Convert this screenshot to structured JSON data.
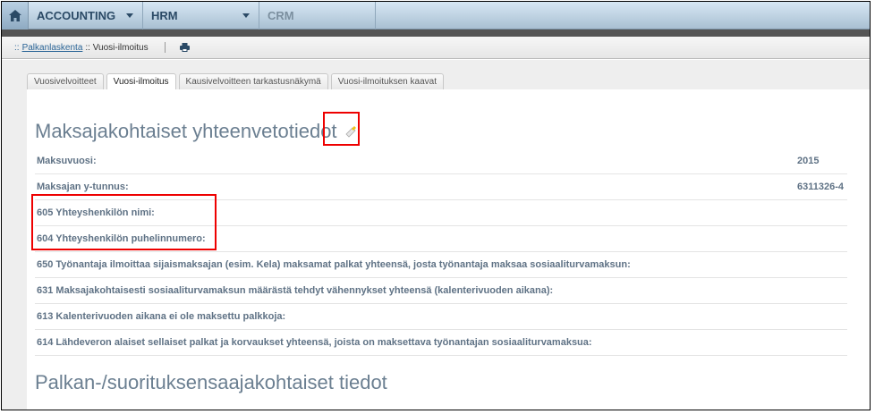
{
  "nav": {
    "items": [
      {
        "label": "ACCOUNTING"
      },
      {
        "label": "HRM"
      },
      {
        "label": "CRM"
      }
    ]
  },
  "breadcrumb": {
    "prefix": "::",
    "link": "Palkanlaskenta",
    "current": ":: Vuosi-ilmoitus"
  },
  "tabs": [
    {
      "label": "Vuosivelvoitteet"
    },
    {
      "label": "Vuosi-ilmoitus"
    },
    {
      "label": "Kausivelvoitteen tarkastusnäkymä"
    },
    {
      "label": "Vuosi-ilmoituksen kaavat"
    }
  ],
  "section1": {
    "title": "Maksajakohtaiset yhteenvetotiedot",
    "rows": [
      {
        "label": "Maksuvuosi:",
        "value": "2015"
      },
      {
        "label": "Maksajan y-tunnus:",
        "value": "6311326-4"
      },
      {
        "label": "605 Yhteyshenkilön nimi:",
        "value": ""
      },
      {
        "label": "604 Yhteyshenkilön puhelinnumero:",
        "value": ""
      },
      {
        "label": "650 Työnantaja ilmoittaa sijaismaksajan (esim. Kela) maksamat palkat yhteensä, josta työnantaja maksaa sosiaaliturvamaksun:",
        "value": ""
      },
      {
        "label": "631 Maksajakohtaisesti sosiaaliturvamaksun määrästä tehdyt vähennykset yhteensä (kalenterivuoden aikana):",
        "value": ""
      },
      {
        "label": "613 Kalenterivuoden aikana ei ole maksettu palkkoja:",
        "value": ""
      },
      {
        "label": "614 Lähdeveron alaiset sellaiset palkat ja korvaukset yhteensä, joista on maksettava työnantajan sosiaaliturvamaksua:",
        "value": ""
      }
    ]
  },
  "section2": {
    "title": "Palkan-/suorituksensaajakohtaiset tiedot"
  }
}
